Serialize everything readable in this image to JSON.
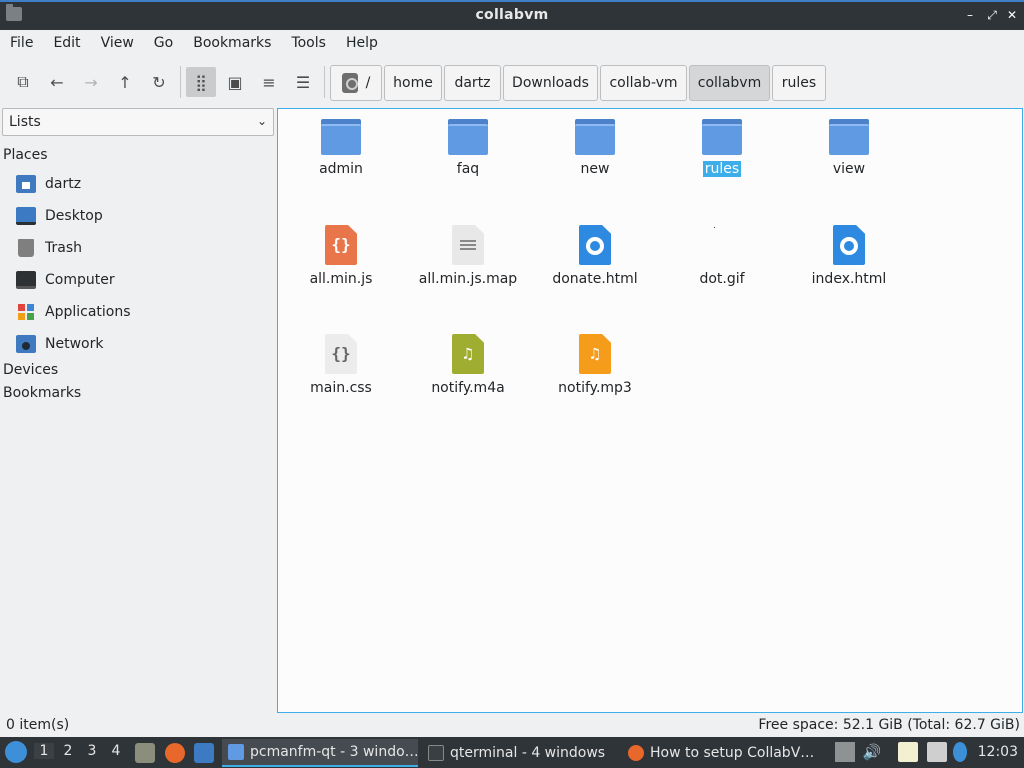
{
  "window": {
    "title": "collabvm",
    "controls": {
      "minimize": "–",
      "maximize": "⤢",
      "close": "✕"
    }
  },
  "menu": [
    "File",
    "Edit",
    "View",
    "Go",
    "Bookmarks",
    "Tools",
    "Help"
  ],
  "toolbar": {
    "icons": {
      "new_tab": "⧉",
      "back": "←",
      "forward": "→",
      "up": "↑",
      "reload": "↻",
      "icon_view": "⣿",
      "thumbnail_view": "▣",
      "compact_view": "≡",
      "detailed_view": "☰"
    }
  },
  "breadcrumb": [
    "/",
    "home",
    "dartz",
    "Downloads",
    "collab-vm",
    "collabvm",
    "rules"
  ],
  "breadcrumb_current": "collabvm",
  "sidebar": {
    "view_select": "Lists",
    "places_header": "Places",
    "places": [
      "dartz",
      "Desktop",
      "Trash",
      "Computer",
      "Applications",
      "Network"
    ],
    "devices_header": "Devices",
    "bookmarks_header": "Bookmarks"
  },
  "files": [
    {
      "name": "admin",
      "kind": "folder"
    },
    {
      "name": "faq",
      "kind": "folder"
    },
    {
      "name": "new",
      "kind": "folder"
    },
    {
      "name": "rules",
      "kind": "folder",
      "selected": true
    },
    {
      "name": "view",
      "kind": "folder"
    },
    {
      "name": "all.min.js",
      "kind": "js"
    },
    {
      "name": "all.min.js.map",
      "kind": "text"
    },
    {
      "name": "donate.html",
      "kind": "html"
    },
    {
      "name": "dot.gif",
      "kind": "gif"
    },
    {
      "name": "index.html",
      "kind": "html"
    },
    {
      "name": "main.css",
      "kind": "css"
    },
    {
      "name": "notify.m4a",
      "kind": "m4a"
    },
    {
      "name": "notify.mp3",
      "kind": "mp3"
    }
  ],
  "status": {
    "left": "0 item(s)",
    "right": "Free space: 52.1 GiB (Total: 62.7 GiB)"
  },
  "taskbar": {
    "workspaces": [
      "1",
      "2",
      "3",
      "4"
    ],
    "active_workspace": "1",
    "tasks": [
      {
        "label": "pcmanfm-qt - 3 windo…",
        "active": true
      },
      {
        "label": "qterminal - 4 windows",
        "active": false
      },
      {
        "label": "How to setup CollabV…",
        "active": false
      }
    ],
    "clock": "12:03"
  },
  "colors": {
    "accent": "#3daee9",
    "folder": "#5f9ae3",
    "titlebar": "#2f3438",
    "selection": "#3daee9"
  }
}
